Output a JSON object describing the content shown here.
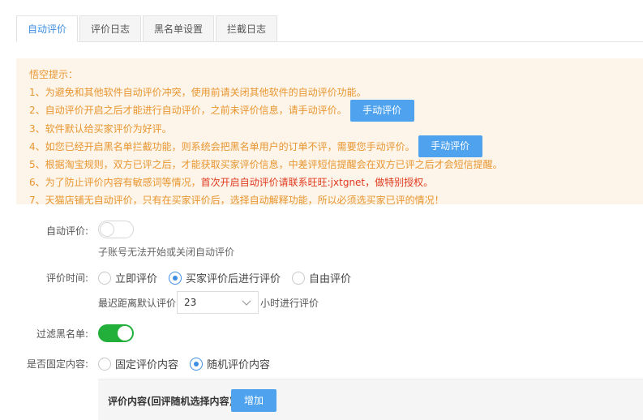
{
  "tabs": [
    {
      "label": "自动评价",
      "active": true
    },
    {
      "label": "评价日志",
      "active": false
    },
    {
      "label": "黑名单设置",
      "active": false
    },
    {
      "label": "拦截日志",
      "active": false
    }
  ],
  "tips": {
    "title": "悟空提示：",
    "line1": "1、为避免和其他软件自动评价冲突，使用前请关闭其他软件的自动评价功能。",
    "line2": "2、自动评价开启之后才能进行自动评价，之前未评价信息，请手动评价。",
    "line2_button": "手动评价",
    "line3": "3、软件默认给买家评价为好评。",
    "line4": "4、如您已经开启黑名单拦截功能，则系统会把黑名单用户的订单不评，需要您手动评价。",
    "line4_button": "手动评价",
    "line5": "5、根据淘宝规则，双方已评之后，才能获取买家评价信息，中差评短信提醒会在双方已评之后才会短信提醒。",
    "line6_prefix": "6、为了防止评价内容有敏感词等情况，",
    "line6_red": "首次开启自动评价请联系旺旺:jxtgnet，做特别授权。",
    "line7": "7、天猫店铺无自动评价，只有在买家评价后，选择自动解释功能，所以必须选买家已评的情况！"
  },
  "form": {
    "auto_review": {
      "label": "自动评价:",
      "enabled": false,
      "hint": "子账号无法开始或关闭自动评价"
    },
    "review_time": {
      "label": "评价时间:",
      "options": [
        {
          "label": "立即评价",
          "checked": false
        },
        {
          "label": "买家评价后进行评价",
          "checked": true
        },
        {
          "label": "自由评价",
          "checked": false
        }
      ],
      "delay_prefix": "最迟距离默认评价",
      "delay_value": "23",
      "delay_suffix": "小时进行评价"
    },
    "filter_blacklist": {
      "label": "过滤黑名单:",
      "enabled": true
    },
    "fixed_content": {
      "label": "是否固定内容:",
      "options": [
        {
          "label": "固定评价内容",
          "checked": false
        },
        {
          "label": "随机评价内容",
          "checked": true
        }
      ]
    },
    "content_section": {
      "title": "评价内容(回评随机选择内容)",
      "add_button": "增加"
    }
  },
  "colors": {
    "accent": "#3d8ee2",
    "button": "#4fa3ee",
    "tip_text": "#e8962f",
    "tip_red": "#e03a1e",
    "tip_bg": "#fdf4ea",
    "toggle_on": "#22b03b"
  }
}
